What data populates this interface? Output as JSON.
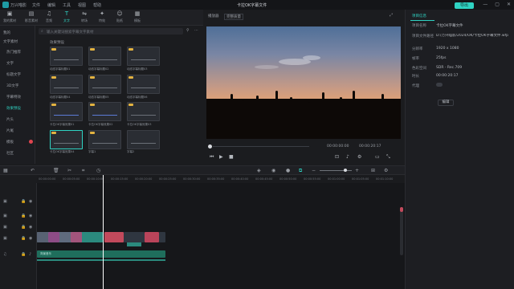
{
  "titlebar": {
    "app_name": "万兴喵影",
    "menu": [
      "文件",
      "编辑",
      "工具",
      "视图",
      "帮助"
    ],
    "project_title": "卡拉OK字幕文件",
    "export": "导出",
    "window_controls": [
      "—",
      "▢",
      "✕"
    ]
  },
  "toolbar": {
    "tools": [
      {
        "label": "我的素材",
        "icon": "▣"
      },
      {
        "label": "影音素材",
        "icon": "▤"
      },
      {
        "label": "音频",
        "icon": "♫"
      },
      {
        "label": "文字",
        "icon": "T"
      },
      {
        "label": "转场",
        "icon": "⇋"
      },
      {
        "label": "特效",
        "icon": "✦"
      },
      {
        "label": "贴纸",
        "icon": "☺"
      },
      {
        "label": "模板",
        "icon": "▦"
      }
    ],
    "active_index": 3
  },
  "sidebar": {
    "items": [
      {
        "label": "我的"
      },
      {
        "label": "文字素材"
      },
      {
        "label": "热门推荐"
      },
      {
        "label": "文字"
      },
      {
        "label": "标题文字"
      },
      {
        "label": "3D文字"
      },
      {
        "label": "字幕特效"
      },
      {
        "label": "效果预设"
      },
      {
        "label": "片头"
      },
      {
        "label": "片尾"
      },
      {
        "label": "模板"
      },
      {
        "label": "社区"
      }
    ],
    "selected_index": 7
  },
  "search": {
    "placeholder": "输入关键词搜索字幕文字素材"
  },
  "browser": {
    "section_title": "效果预设",
    "cards": [
      {
        "label": "动态字幕标题01"
      },
      {
        "label": "动态字幕标题02"
      },
      {
        "label": "动态字幕标题03"
      },
      {
        "label": "动态字幕标题04"
      },
      {
        "label": "动态字幕标题05"
      },
      {
        "label": "动态字幕标题06"
      },
      {
        "label": "卡拉OK字幕效果01"
      },
      {
        "label": "卡拉OK字幕效果02"
      },
      {
        "label": "卡拉OK字幕效果03"
      },
      {
        "label": "卡拉OK字幕效果04"
      },
      {
        "label": "字幕1"
      },
      {
        "label": "字幕2"
      }
    ],
    "selected_index": 9
  },
  "preview": {
    "tabs": [
      "播放器",
      "完整质量"
    ],
    "time_current": "00:00:00:00",
    "time_total": "00:00:20:17"
  },
  "properties": {
    "tab": "项目信息",
    "fields": [
      {
        "label": "项目名称",
        "value": "卡拉OK字幕文件"
      },
      {
        "label": "项目文件路径",
        "value": "D:/万兴喵影/2024/OK/卡拉OK字幕文件.wfp"
      },
      {
        "label": "分辨率",
        "value": "1920 x 1080"
      },
      {
        "label": "帧率",
        "value": "25fps"
      },
      {
        "label": "色彩空间",
        "value": "SDR - Rec.709"
      },
      {
        "label": "时长",
        "value": "00:00:20:17"
      },
      {
        "label": "代理",
        "value": ""
      }
    ],
    "edit_button": "编辑"
  },
  "timeline": {
    "ruler": [
      "00:00:00:00",
      "00:00:05:00",
      "00:00:10:00",
      "00:00:15:00",
      "00:00:20:00",
      "00:00:25:00",
      "00:00:30:00",
      "00:00:35:00",
      "00:00:40:00",
      "00:00:45:00",
      "00:00:50:00",
      "00:00:55:00",
      "00:01:00:00",
      "00:01:05:00",
      "00:01:10:00"
    ],
    "audio_label": "背景音乐"
  },
  "colors": {
    "accent": "#2fd3c3",
    "clip": "#2b8a7e",
    "title_clip": "#c24a5c"
  }
}
